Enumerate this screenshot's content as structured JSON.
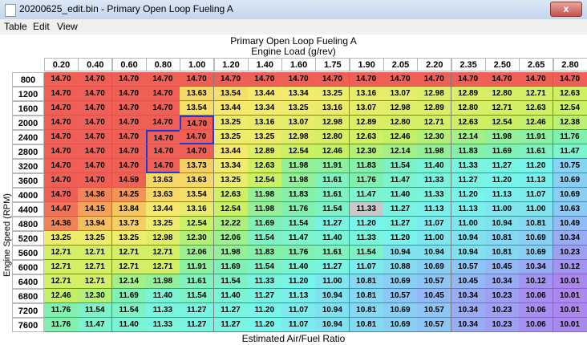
{
  "window": {
    "title": "20200625_edit.bin - Primary Open Loop Fueling A",
    "close_label": "x"
  },
  "menu": [
    "Table",
    "Edit",
    "View"
  ],
  "table": {
    "title": "Primary Open Loop Fueling A",
    "x_axis_label": "Engine Load (g/rev)",
    "y_axis_label": "Engine Speed (RPM)",
    "value_label": "Estimated Air/Fuel Ratio",
    "load_columns": [
      "0.20",
      "0.40",
      "0.60",
      "0.80",
      "1.00",
      "1.20",
      "1.40",
      "1.60",
      "1.75",
      "1.90",
      "2.05",
      "2.20",
      "2.35",
      "2.50",
      "2.65",
      "2.80"
    ],
    "rpm_rows": [
      "800",
      "1200",
      "1600",
      "2000",
      "2400",
      "2800",
      "3200",
      "3600",
      "4000",
      "4400",
      "4800",
      "5200",
      "5600",
      "6000",
      "6400",
      "6800",
      "7200",
      "7600"
    ],
    "values": [
      [
        "14.70",
        "14.70",
        "14.70",
        "14.70",
        "14.70",
        "14.70",
        "14.70",
        "14.70",
        "14.70",
        "14.70",
        "14.70",
        "14.70",
        "14.70",
        "14.70",
        "14.70",
        "14.70"
      ],
      [
        "14.70",
        "14.70",
        "14.70",
        "14.70",
        "13.63",
        "13.54",
        "13.44",
        "13.34",
        "13.25",
        "13.16",
        "13.07",
        "12.98",
        "12.89",
        "12.80",
        "12.71",
        "12.63"
      ],
      [
        "14.70",
        "14.70",
        "14.70",
        "14.70",
        "13.54",
        "13.44",
        "13.34",
        "13.25",
        "13.16",
        "13.07",
        "12.98",
        "12.89",
        "12.80",
        "12.71",
        "12.63",
        "12.54"
      ],
      [
        "14.70",
        "14.70",
        "14.70",
        "14.70",
        "14.70",
        "13.25",
        "13.16",
        "13.07",
        "12.98",
        "12.89",
        "12.80",
        "12.71",
        "12.63",
        "12.54",
        "12.46",
        "12.38"
      ],
      [
        "14.70",
        "14.70",
        "14.70",
        "14.70",
        "14.70",
        "13.25",
        "13.25",
        "12.98",
        "12.80",
        "12.63",
        "12.46",
        "12.30",
        "12.14",
        "11.98",
        "11.91",
        "11.76"
      ],
      [
        "14.70",
        "14.70",
        "14.70",
        "14.70",
        "14.70",
        "13.44",
        "12.89",
        "12.54",
        "12.46",
        "12.30",
        "12.14",
        "11.98",
        "11.83",
        "11.69",
        "11.61",
        "11.47"
      ],
      [
        "14.70",
        "14.70",
        "14.70",
        "14.70",
        "13.73",
        "13.34",
        "12.63",
        "11.98",
        "11.91",
        "11.83",
        "11.54",
        "11.40",
        "11.33",
        "11.27",
        "11.20",
        "10.75"
      ],
      [
        "14.70",
        "14.70",
        "14.59",
        "13.63",
        "13.63",
        "13.25",
        "12.54",
        "11.98",
        "11.61",
        "11.76",
        "11.47",
        "11.33",
        "11.27",
        "11.20",
        "11.13",
        "10.69"
      ],
      [
        "14.70",
        "14.36",
        "14.25",
        "13.63",
        "13.54",
        "12.63",
        "11.98",
        "11.83",
        "11.61",
        "11.47",
        "11.40",
        "11.33",
        "11.20",
        "11.13",
        "11.07",
        "10.69"
      ],
      [
        "14.47",
        "14.15",
        "13.84",
        "13.44",
        "13.16",
        "12.54",
        "11.98",
        "11.76",
        "11.54",
        "11.33",
        "11.27",
        "11.13",
        "11.13",
        "11.00",
        "11.00",
        "10.63"
      ],
      [
        "14.36",
        "13.94",
        "13.73",
        "13.25",
        "12.54",
        "12.22",
        "11.69",
        "11.54",
        "11.27",
        "11.20",
        "11.27",
        "11.07",
        "11.00",
        "10.94",
        "10.81",
        "10.49"
      ],
      [
        "13.25",
        "13.25",
        "13.25",
        "12.98",
        "12.30",
        "12.06",
        "11.54",
        "11.47",
        "11.40",
        "11.33",
        "11.20",
        "11.00",
        "10.94",
        "10.81",
        "10.69",
        "10.34"
      ],
      [
        "12.71",
        "12.71",
        "12.71",
        "12.71",
        "12.06",
        "11.98",
        "11.83",
        "11.76",
        "11.61",
        "11.54",
        "10.94",
        "10.94",
        "10.94",
        "10.81",
        "10.69",
        "10.23"
      ],
      [
        "12.71",
        "12.71",
        "12.71",
        "12.71",
        "11.91",
        "11.69",
        "11.54",
        "11.40",
        "11.27",
        "11.07",
        "10.88",
        "10.69",
        "10.57",
        "10.45",
        "10.34",
        "10.12"
      ],
      [
        "12.71",
        "12.71",
        "12.14",
        "11.98",
        "11.61",
        "11.54",
        "11.33",
        "11.20",
        "11.00",
        "10.81",
        "10.69",
        "10.57",
        "10.45",
        "10.34",
        "10.12",
        "10.01"
      ],
      [
        "12.46",
        "12.30",
        "11.69",
        "11.40",
        "11.54",
        "11.40",
        "11.27",
        "11.13",
        "10.94",
        "10.81",
        "10.57",
        "10.45",
        "10.34",
        "10.23",
        "10.06",
        "10.01"
      ],
      [
        "11.76",
        "11.54",
        "11.54",
        "11.33",
        "11.27",
        "11.27",
        "11.20",
        "11.07",
        "10.94",
        "10.81",
        "10.69",
        "10.57",
        "10.34",
        "10.23",
        "10.06",
        "10.01"
      ],
      [
        "11.76",
        "11.47",
        "11.40",
        "11.33",
        "11.27",
        "11.27",
        "11.20",
        "11.07",
        "10.94",
        "10.81",
        "10.69",
        "10.57",
        "10.34",
        "10.23",
        "10.06",
        "10.01"
      ]
    ],
    "highlighted_cell_color": "#c8c8c8",
    "selection_color": "#1f3bd6"
  }
}
